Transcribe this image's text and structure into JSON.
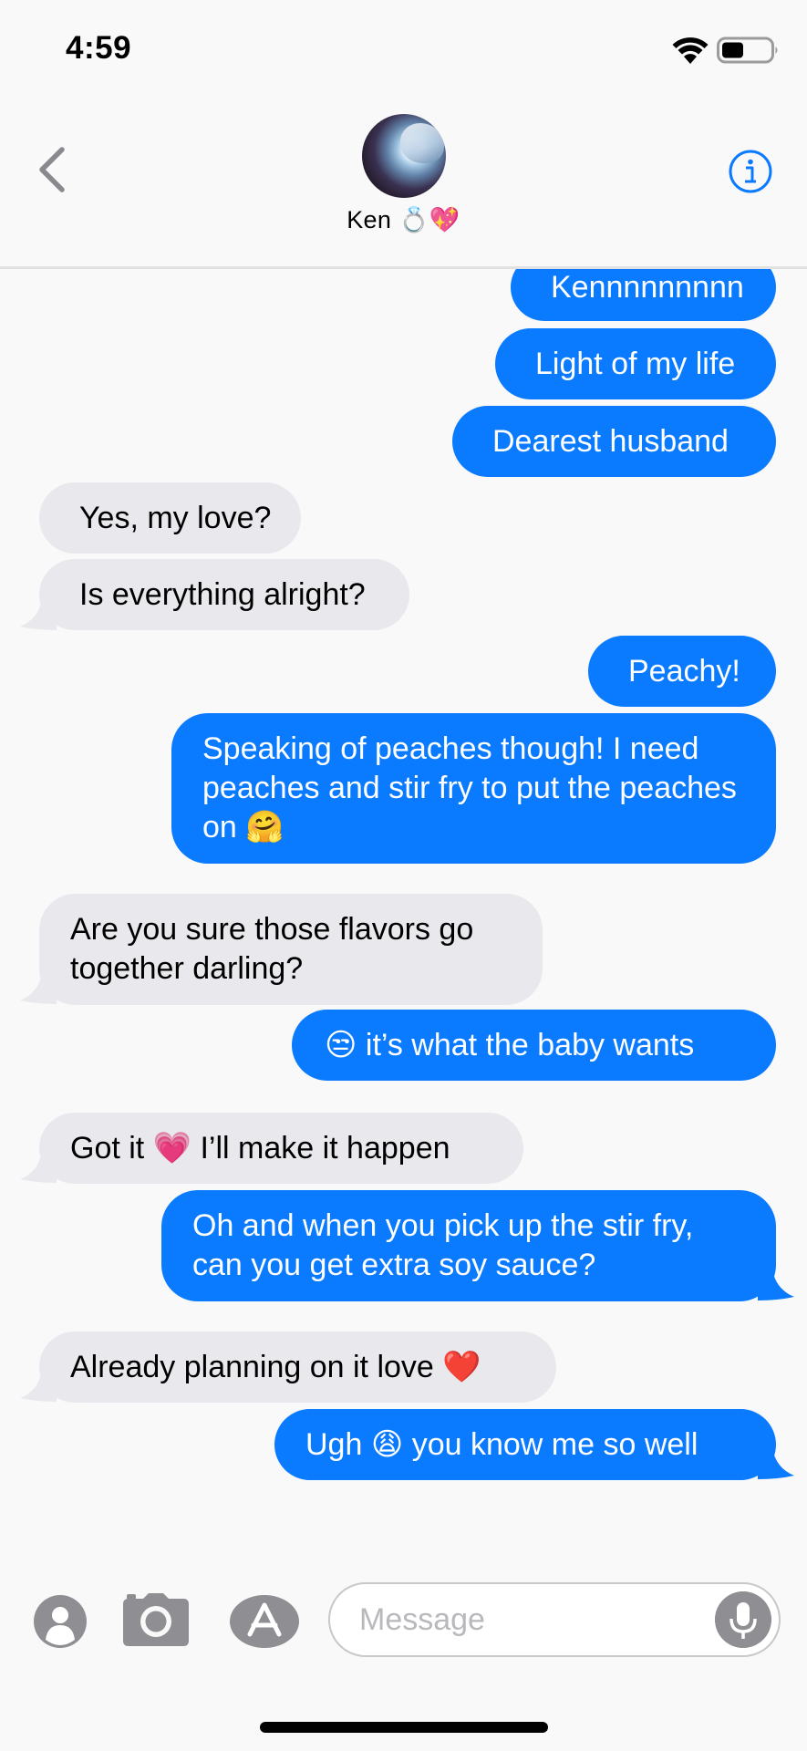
{
  "status_bar": {
    "time": "4:59",
    "wifi_icon": "wifi-icon",
    "battery_icon": "battery-icon"
  },
  "header": {
    "back_icon": "chevron-left-icon",
    "contact_name": "Ken 💍💖",
    "info_icon": "info-icon"
  },
  "messages": [
    {
      "sender": "me",
      "text": "Kennnnnnnnn"
    },
    {
      "sender": "me",
      "text": "Light of my life"
    },
    {
      "sender": "me",
      "text": "Dearest husband"
    },
    {
      "sender": "ken",
      "text": "Yes, my love?"
    },
    {
      "sender": "ken",
      "text": "Is everything alright?"
    },
    {
      "sender": "me",
      "text": "Peachy!"
    },
    {
      "sender": "me",
      "text": "Speaking of peaches though! I need peaches and stir fry to put the peaches on 🤗"
    },
    {
      "sender": "ken",
      "text": "Are you sure those flavors go together darling?"
    },
    {
      "sender": "me",
      "text": "😒 it’s what the baby wants"
    },
    {
      "sender": "ken",
      "text": "Got it 💗 I’ll make it happen"
    },
    {
      "sender": "me",
      "text": "Oh and when you pick up the stir fry, can you get extra soy sauce?"
    },
    {
      "sender": "ken",
      "text": "Already planning on it love ❤️"
    },
    {
      "sender": "me",
      "text": "Ugh 😩 you know me so well"
    }
  ],
  "input_bar": {
    "contact_icon": "memoji-icon",
    "camera_icon": "camera-icon",
    "apps_icon": "app-store-icon",
    "placeholder": "Message",
    "mic_icon": "microphone-icon"
  },
  "colors": {
    "sent_bubble": "#0a7aff",
    "received_bubble": "#e9e8ec",
    "accent": "#0a7aff"
  }
}
